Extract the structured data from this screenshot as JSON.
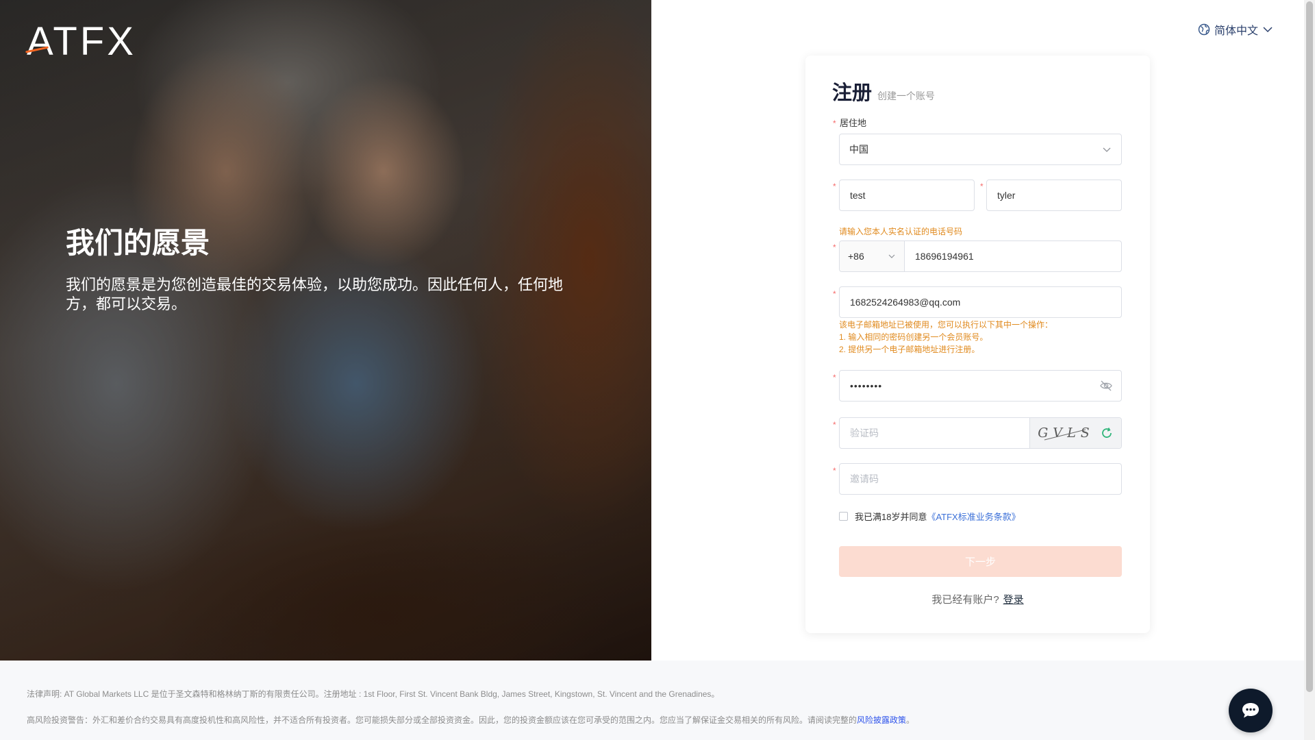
{
  "brand": {
    "logo_text": "ATFX"
  },
  "hero": {
    "title": "我们的愿景",
    "body": "我们的愿景是为您创造最佳的交易体验，以助您成功。因此任何人，任何地方，都可以交易。"
  },
  "language": {
    "label": "简体中文",
    "icon": "globe-icon"
  },
  "form": {
    "title": "注册",
    "subtitle": "创建一个账号",
    "required_mark": "*",
    "residence": {
      "label": "居住地",
      "value": "中国"
    },
    "first_name": {
      "value": "test"
    },
    "last_name": {
      "value": "tyler"
    },
    "phone": {
      "hint": "请输入您本人实名认证的电话号码",
      "country_code": "+86",
      "number": "18696194961"
    },
    "email": {
      "value": "1682524264983@qq.com",
      "errors": [
        "该电子邮箱地址已被使用，您可以执行以下其中一个操作：",
        "1. 输入相同的密码创建另一个会员账号。",
        "2. 提供另一个电子邮箱地址进行注册。"
      ]
    },
    "password": {
      "masked_value": "••••••••",
      "toggle_icon": "eye-off-icon"
    },
    "captcha": {
      "placeholder": "验证码",
      "image_text": "GVLS",
      "refresh_icon": "refresh-icon"
    },
    "invite_code": {
      "placeholder": "邀请码"
    },
    "agreement": {
      "text": "我已满18岁并同意",
      "link": "《ATFX标准业务条款》",
      "checked": false
    },
    "submit": {
      "label": "下一步"
    },
    "login_prompt": {
      "text": "我已经有账户?",
      "link": "登录"
    }
  },
  "footer": {
    "legal": "法律声明: AT Global Markets LLC 是位于圣文森特和格林纳丁斯的有限责任公司。注册地址 : 1st Floor, First St. Vincent Bank Bldg, James Street, Kingstown, St. Vincent and the Grenadines。",
    "risk_text": "高风险投资警告：外汇和差价合约交易具有高度投机性和高风险性，并不适合所有投资者。您可能损失部分或全部投资资金。因此，您的投资金额应该在您可承受的范围之内。您应当了解保证金交易相关的所有风险。请阅读完整的",
    "risk_link": "风险披露政策",
    "risk_end": "。"
  },
  "chat": {
    "icon": "chat-icon"
  },
  "colors": {
    "accent": "#f26522",
    "warning": "#e08a1e",
    "link": "#3a6fd8",
    "required": "#f56c6c",
    "button_disabled": "#fcdcd1",
    "chat": "#0e1a2b"
  }
}
